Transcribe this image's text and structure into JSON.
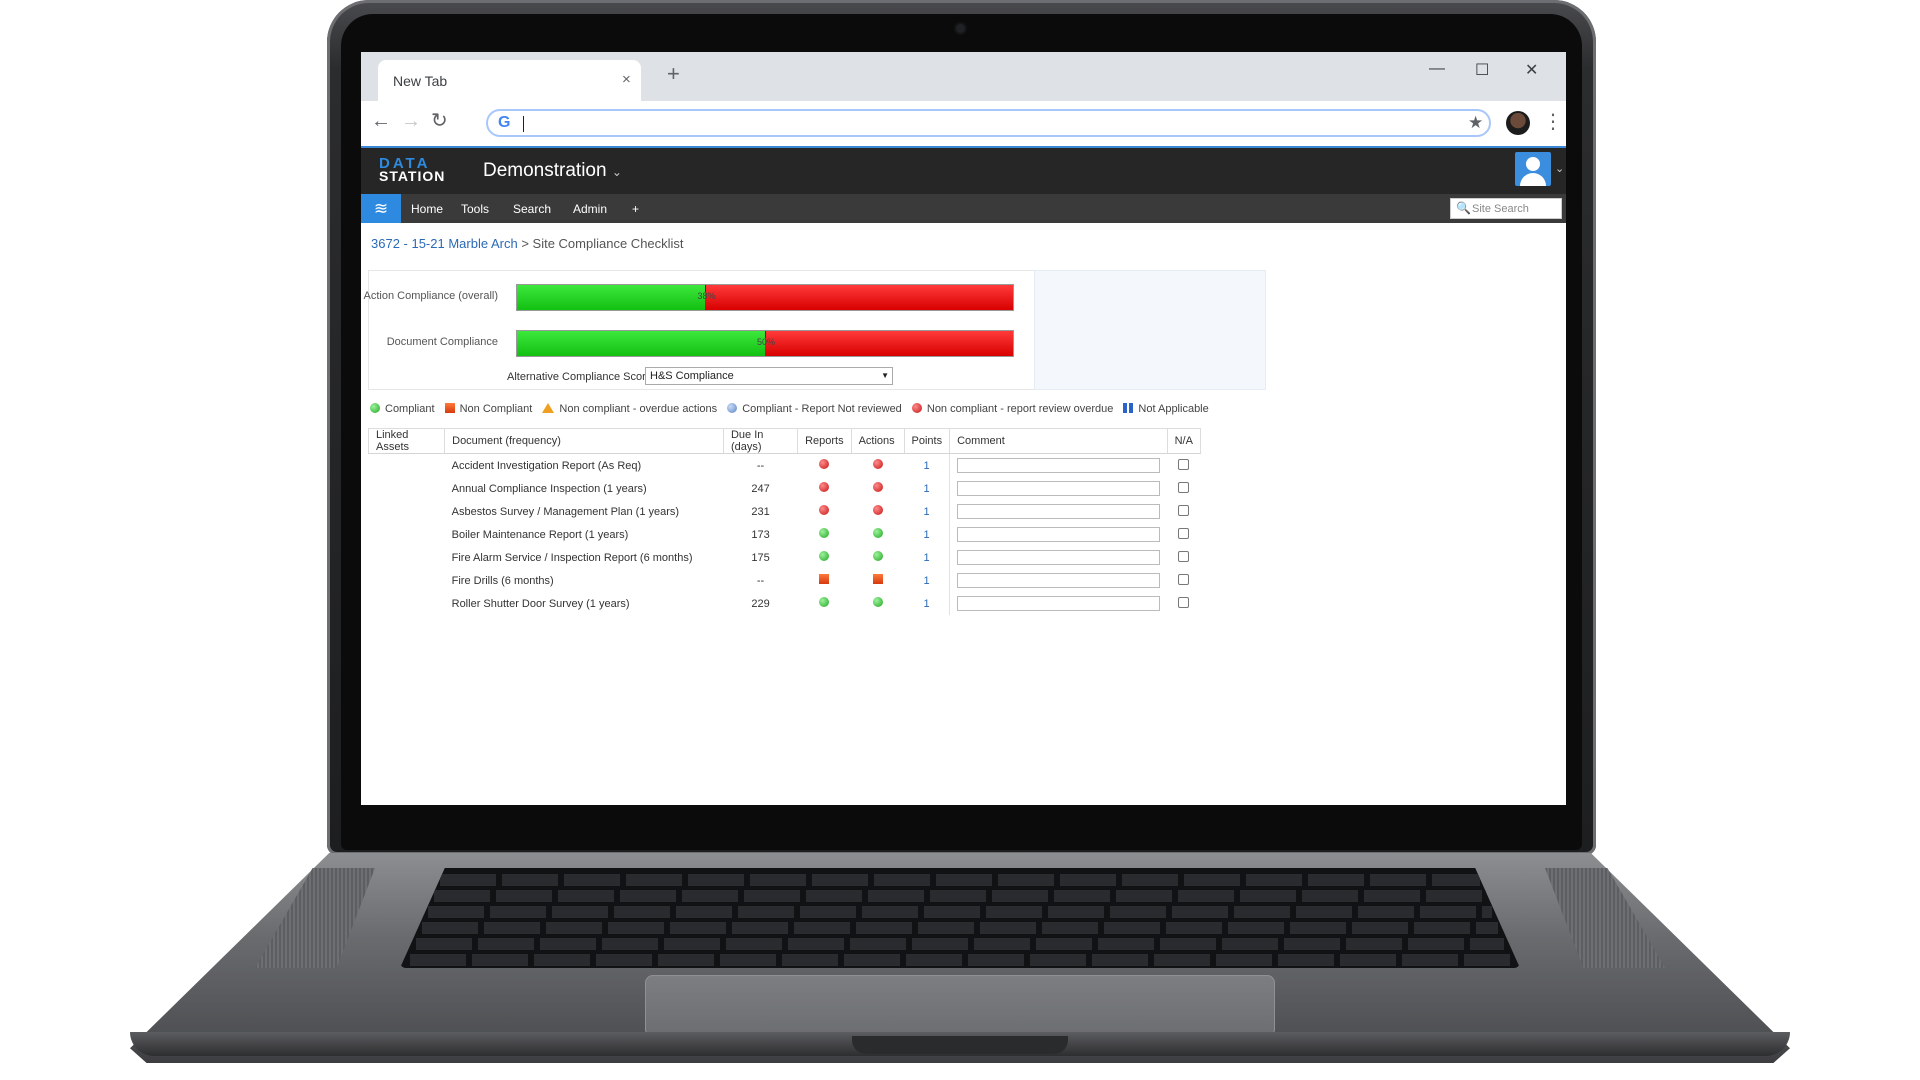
{
  "browser": {
    "tab_title": "New Tab",
    "tab_close": "×",
    "new_tab": "+",
    "win_minimize": "—",
    "win_maximize": "☐",
    "win_close": "✕",
    "back": "←",
    "forward": "→",
    "reload": "↻",
    "omnibox_value": "",
    "google_icon": "G",
    "star": "★",
    "menu": "⋮"
  },
  "app": {
    "logo_line1": "DATA",
    "logo_line2": "STATION",
    "name": "Demonstration",
    "name_chevron": "⌄",
    "user_chevron": "⌄"
  },
  "menu": {
    "items": [
      "Home",
      "Tools",
      "Search",
      "Admin",
      "+"
    ],
    "site_search_placeholder": "Site Search",
    "site_search_icon": "🔍",
    "logo_icon": "≋"
  },
  "breadcrumb": {
    "link": "3672 - 15-21 Marble Arch",
    "separator": " > ",
    "current": "Site Compliance Checklist"
  },
  "compliance": {
    "bars": [
      {
        "label": "Action Compliance (overall)",
        "percent": 38,
        "percent_text": "38%"
      },
      {
        "label": "Document Compliance",
        "percent": 50,
        "percent_text": "50%"
      }
    ],
    "alt_label": "Alternative Compliance Scores:",
    "alt_selected": "H&S Compliance",
    "colors": {
      "green": "#22c322",
      "red": "#e00000"
    }
  },
  "legend": [
    {
      "icon": "green-dot",
      "label": "Compliant"
    },
    {
      "icon": "orange-square",
      "label": "Non Compliant"
    },
    {
      "icon": "warning-triangle",
      "label": "Non compliant - overdue actions"
    },
    {
      "icon": "blue-dot",
      "label": "Compliant - Report Not reviewed"
    },
    {
      "icon": "red-question-dot",
      "label": "Non compliant - report review overdue"
    },
    {
      "icon": "na-icon",
      "label": "Not Applicable"
    }
  ],
  "table": {
    "headers": [
      "Linked Assets",
      "Document (frequency)",
      "Due In (days)",
      "Reports",
      "Actions",
      "Points",
      "Comment",
      "N/A"
    ],
    "rows": [
      {
        "linked": "",
        "document": "Accident Investigation Report (As Req)",
        "due": "--",
        "reports": "red-question",
        "actions": "red-question",
        "points": "1",
        "comment": "",
        "na": false
      },
      {
        "linked": "",
        "document": "Annual Compliance Inspection (1 years)",
        "due": "247",
        "reports": "red-question",
        "actions": "red-question",
        "points": "1",
        "comment": "",
        "na": false
      },
      {
        "linked": "",
        "document": "Asbestos Survey / Management Plan (1 years)",
        "due": "231",
        "reports": "red-question",
        "actions": "red-question",
        "points": "1",
        "comment": "",
        "na": false
      },
      {
        "linked": "",
        "document": "Boiler Maintenance Report (1 years)",
        "due": "173",
        "reports": "green",
        "actions": "green",
        "points": "1",
        "comment": "",
        "na": false
      },
      {
        "linked": "",
        "document": "Fire Alarm Service / Inspection Report (6 months)",
        "due": "175",
        "reports": "green",
        "actions": "green",
        "points": "1",
        "comment": "",
        "na": false
      },
      {
        "linked": "",
        "document": "Fire Drills (6 months)",
        "due": "--",
        "reports": "orange-square",
        "actions": "orange-square",
        "points": "1",
        "comment": "",
        "na": false
      },
      {
        "linked": "",
        "document": "Roller Shutter Door Survey (1 years)",
        "due": "229",
        "reports": "green",
        "actions": "green",
        "points": "1",
        "comment": "",
        "na": false
      }
    ]
  }
}
